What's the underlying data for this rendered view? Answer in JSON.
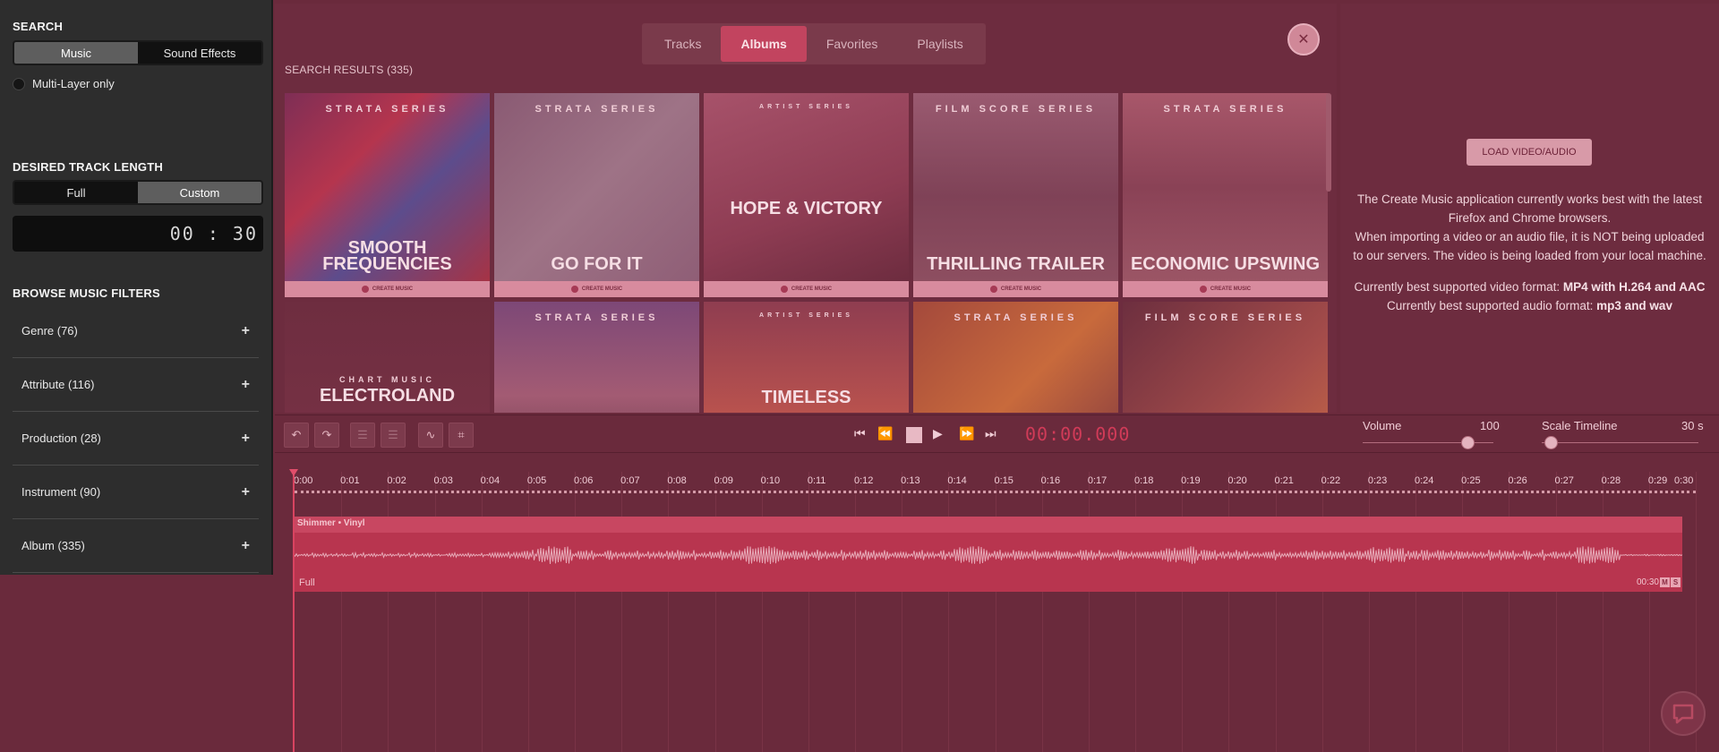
{
  "sidebar": {
    "search_heading": "SEARCH",
    "search_modes": [
      "Music",
      "Sound Effects"
    ],
    "active_search_mode": "Music",
    "multilayer_label": "Multi-Layer only",
    "length_heading": "DESIRED TRACK LENGTH",
    "length_modes": [
      "Full",
      "Custom"
    ],
    "active_length_mode": "Custom",
    "time_value": "00 : 30",
    "filters_heading": "BROWSE MUSIC FILTERS",
    "filters": [
      {
        "label": "Genre (76)",
        "icon": "plus-icon"
      },
      {
        "label": "Attribute (116)",
        "icon": "plus-icon"
      },
      {
        "label": "Production (28)",
        "icon": "plus-icon"
      },
      {
        "label": "Instrument (90)",
        "icon": "plus-icon"
      },
      {
        "label": "Album (335)",
        "icon": "plus-icon"
      }
    ]
  },
  "top": {
    "tabs": [
      "Tracks",
      "Albums",
      "Favorites",
      "Playlists"
    ],
    "active_tab": "Albums",
    "results_label": "SEARCH RESULTS (335)",
    "albums": [
      {
        "series": "STRATA SERIES",
        "title": "SMOOTH FREQUENCIES",
        "brand": "CREATE MUSIC"
      },
      {
        "series": "STRATA SERIES",
        "title": "GO FOR IT",
        "brand": "CREATE MUSIC"
      },
      {
        "series": "ARTIST SERIES",
        "title": "HOPE & VICTORY",
        "brand": "CREATE MUSIC"
      },
      {
        "series": "FILM SCORE SERIES",
        "title": "THRILLING TRAILER",
        "brand": "CREATE MUSIC"
      },
      {
        "series": "STRATA SERIES",
        "title": "ECONOMIC UPSWING",
        "brand": "CREATE MUSIC"
      },
      {
        "series": "CHART MUSIC",
        "title": "ELECTROLAND",
        "brand": ""
      },
      {
        "series": "STRATA SERIES",
        "title": "",
        "brand": ""
      },
      {
        "series": "ARTIST SERIES",
        "title": "TIMELESS",
        "brand": ""
      },
      {
        "series": "STRATA SERIES",
        "title": "",
        "brand": ""
      },
      {
        "series": "FILM SCORE SERIES",
        "title": "",
        "brand": ""
      }
    ]
  },
  "info": {
    "load_button": "LOAD VIDEO/AUDIO",
    "line1": "The Create Music application currently works best with the latest Firefox and Chrome browsers.",
    "line2": "When importing a video or an audio file, it is NOT being uploaded to our servers. The video is being loaded from your local machine.",
    "video_prefix": "Currently best supported video format: ",
    "video_format": "MP4 with H.264 and AAC",
    "audio_prefix": "Currently best supported audio format: ",
    "audio_format": "mp3 and wav"
  },
  "transport": {
    "clock": "00:00.000",
    "volume_label": "Volume",
    "volume_value": "100",
    "scale_label": "Scale Timeline",
    "scale_value": "30 s"
  },
  "timeline": {
    "ticks": [
      "0:00",
      "0:01",
      "0:02",
      "0:03",
      "0:04",
      "0:05",
      "0:06",
      "0:07",
      "0:08",
      "0:09",
      "0:10",
      "0:11",
      "0:12",
      "0:13",
      "0:14",
      "0:15",
      "0:16",
      "0:17",
      "0:18",
      "0:19",
      "0:20",
      "0:21",
      "0:22",
      "0:23",
      "0:24",
      "0:25",
      "0:26",
      "0:27",
      "0:28",
      "0:29",
      "0:30"
    ],
    "track_name": "Shimmer • Vinyl",
    "track_length_label": "Full",
    "track_duration": "00:30",
    "badge_m": "M",
    "badge_s": "S"
  },
  "colors": {
    "accent": "#c2445f",
    "clock": "#d03b58",
    "track": "#b8354f"
  }
}
